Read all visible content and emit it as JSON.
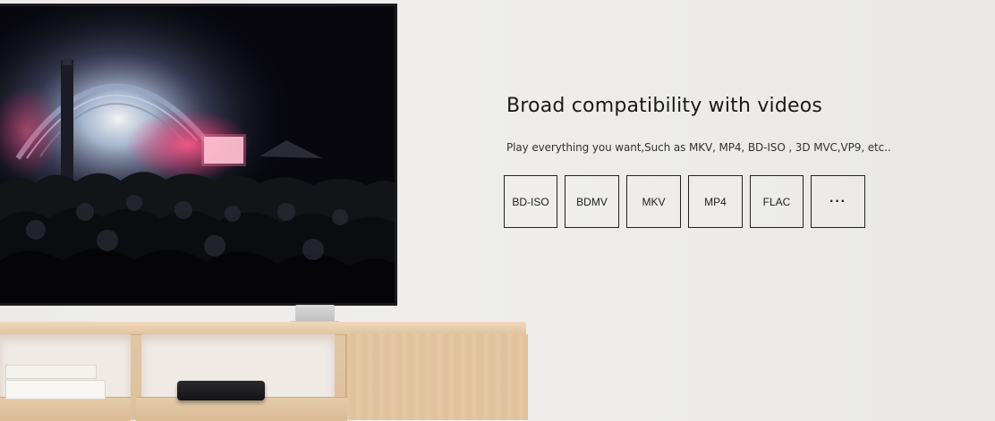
{
  "headline": "Broad compatibility with videos",
  "subline": "Play everything you want,Such as MKV, MP4, BD-ISO , 3D MVC,VP9, etc..",
  "formats": [
    "BD-ISO",
    "BDMV",
    "MKV",
    "MP4",
    "FLAC",
    "···"
  ],
  "colors": {
    "wall": "#ecebe9",
    "text": "#1a1a1a",
    "badge_border": "#222222",
    "wood": "#e3c8a6",
    "tv_bezel": "#0c0c12"
  }
}
